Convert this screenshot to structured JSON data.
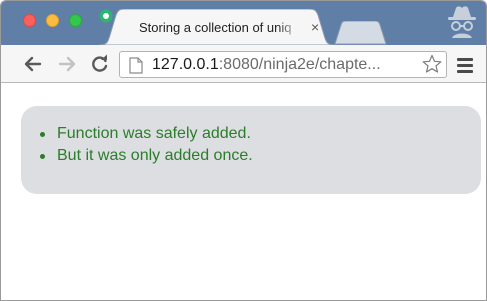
{
  "tab": {
    "title": "Storing a collection of uniq",
    "close_glyph": "×",
    "favicon": "circle-favicon-icon"
  },
  "address_bar": {
    "host": "127.0.0.1",
    "rest": ":8080/ninja2e/chapte..."
  },
  "toolbar": {
    "back_icon": "back-arrow-icon",
    "forward_icon": "forward-arrow-icon",
    "reload_icon": "reload-icon",
    "star_icon": "star-icon",
    "menu_icon": "hamburger-menu-icon"
  },
  "results": {
    "items": [
      "Function was safely added.",
      "But it was only added once."
    ]
  },
  "colors": {
    "titlebar": "#5f7fa6",
    "result_text": "#2a7d2a",
    "result_box": "#dddee1"
  }
}
